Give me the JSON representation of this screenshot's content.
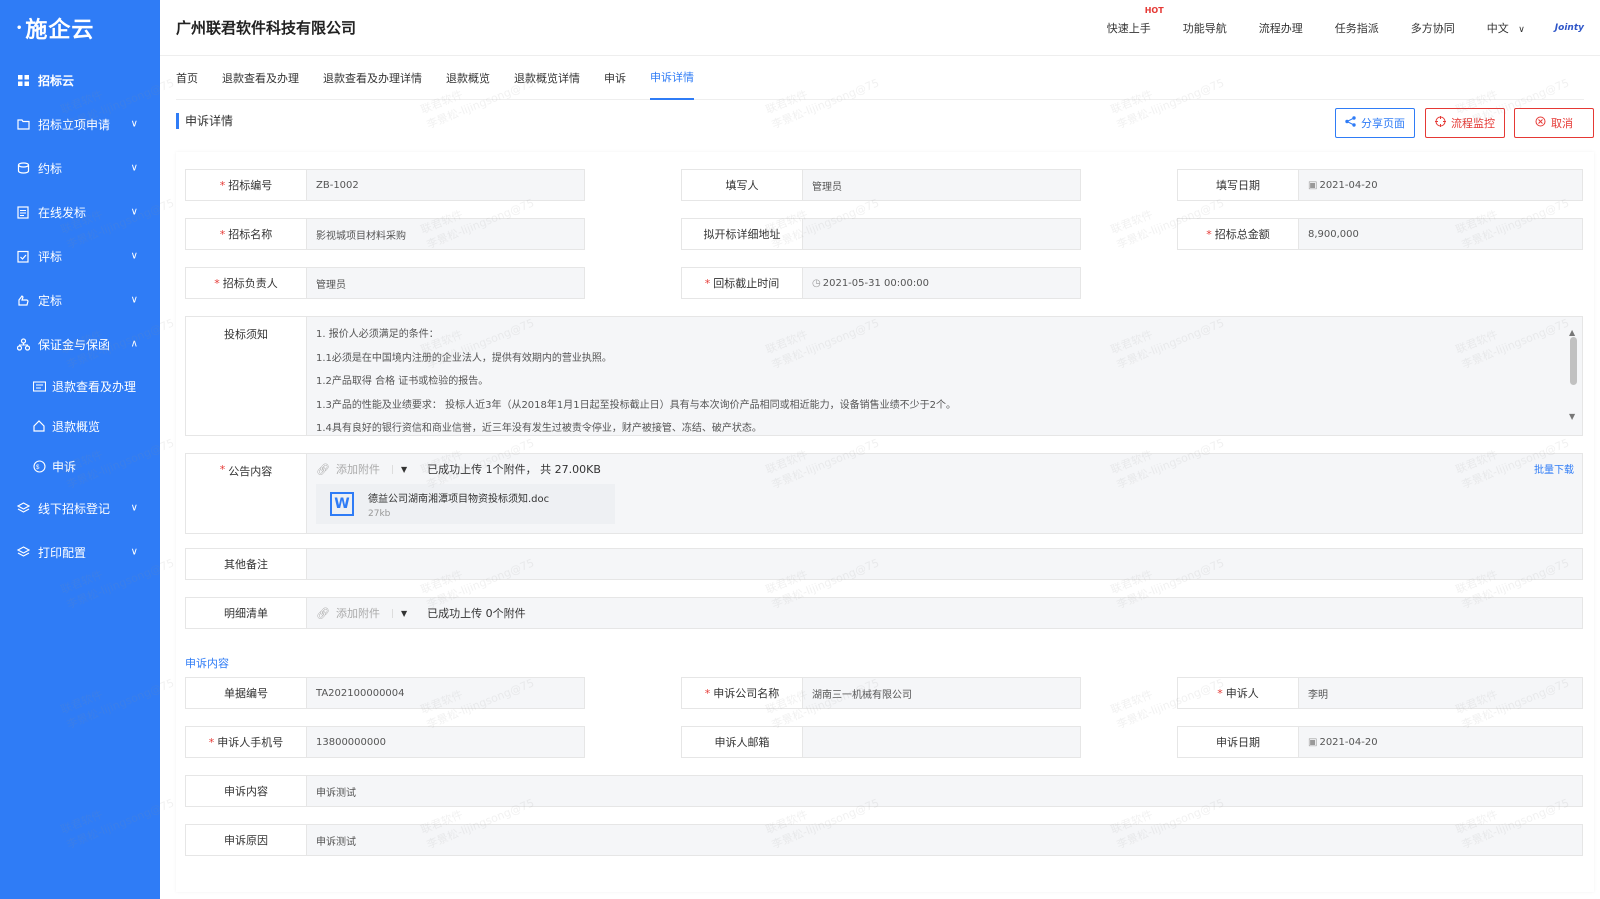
{
  "sidebar": {
    "logo": "施企云",
    "items": [
      {
        "label": "招标云",
        "icon": "grid-icon"
      },
      {
        "label": "招标立项申请",
        "icon": "folder-icon"
      },
      {
        "label": "约标",
        "icon": "coins-icon"
      },
      {
        "label": "在线发标",
        "icon": "document-icon"
      },
      {
        "label": "评标",
        "icon": "clipboard-check-icon"
      },
      {
        "label": "定标",
        "icon": "hand-icon"
      },
      {
        "label": "保证金与保函",
        "icon": "org-chart-icon"
      }
    ],
    "subitems": [
      {
        "label": "退款查看及办理",
        "icon": "card-icon"
      },
      {
        "label": "退款概览",
        "icon": "home-icon"
      },
      {
        "label": "申诉",
        "icon": "badge-icon"
      }
    ],
    "bottom_items": [
      {
        "label": "线下招标登记",
        "icon": "layers-icon"
      },
      {
        "label": "打印配置",
        "icon": "layers-icon"
      }
    ]
  },
  "header": {
    "company": "广州联君软件科技有限公司",
    "nav": [
      "快速上手",
      "功能导航",
      "流程办理",
      "任务指派",
      "多方协同"
    ],
    "hot_badge": "HOT",
    "language": "中文",
    "brand": "Jointy"
  },
  "tabs": [
    "首页",
    "退款查看及办理",
    "退款查看及办理详情",
    "退款概览",
    "退款概览详情",
    "申诉",
    "申诉详情"
  ],
  "page": {
    "title": "申诉详情",
    "share": "分享页面",
    "flow": "流程监控",
    "cancel": "取消"
  },
  "form": {
    "bid_no": {
      "label": "招标编号",
      "value": "ZB-1002"
    },
    "filler": {
      "label": "填写人",
      "value": "管理员"
    },
    "fill_date": {
      "label": "填写日期",
      "value": "2021-04-20"
    },
    "bid_name": {
      "label": "招标名称",
      "value": "影视城项目材料采购"
    },
    "address": {
      "label": "拟开标详细地址",
      "value": ""
    },
    "amount": {
      "label": "招标总金额",
      "value": "8,900,000"
    },
    "owner": {
      "label": "招标负责人",
      "value": "管理员"
    },
    "deadline": {
      "label": "回标截止时间",
      "value": "2021-05-31 00:00:00"
    },
    "notice": {
      "label": "投标须知",
      "lines": [
        "1. 报价人必须满足的条件：",
        "1.1必须是在中国境内注册的企业法人，提供有效期内的营业执照。",
        "1.2产品取得 合格 证书或检验的报告。",
        "1.3产品的性能及业绩要求： 投标人近3年（从2018年1月1日起至投标截止日）具有与本次询价产品相同或相近能力，设备销售业绩不少于2个。",
        "1.4具有良好的银行资信和商业信誉，近三年没有发生过被责令停业，财产被接管、冻结、破产状态。"
      ]
    },
    "announcement": {
      "label": "公告内容",
      "add": "添加附件",
      "status": "已成功上传 1个附件， 共 27.00KB",
      "batch": "批量下载",
      "file_name": "德益公司湖南湘潭项目物资投标须知.doc",
      "file_size": "27kb"
    },
    "remarks": {
      "label": "其他备注",
      "value": ""
    },
    "detail_list": {
      "label": "明细清单",
      "add": "添加附件",
      "status": "已成功上传 0个附件"
    }
  },
  "complaint": {
    "section": "申诉内容",
    "doc_no": {
      "label": "单据编号",
      "value": "TA202100000004"
    },
    "company": {
      "label": "申诉公司名称",
      "value": "湖南三一机械有限公司"
    },
    "person": {
      "label": "申诉人",
      "value": "李明"
    },
    "phone": {
      "label": "申诉人手机号",
      "value": "13800000000"
    },
    "email": {
      "label": "申诉人邮箱",
      "value": ""
    },
    "date": {
      "label": "申诉日期",
      "value": "2021-04-20"
    },
    "content": {
      "label": "申诉内容",
      "value": "申诉测试"
    },
    "reason": {
      "label": "申诉原因",
      "value": "申诉测试"
    }
  },
  "watermark": [
    "联君软件",
    "李景松-lijingsong@75"
  ]
}
